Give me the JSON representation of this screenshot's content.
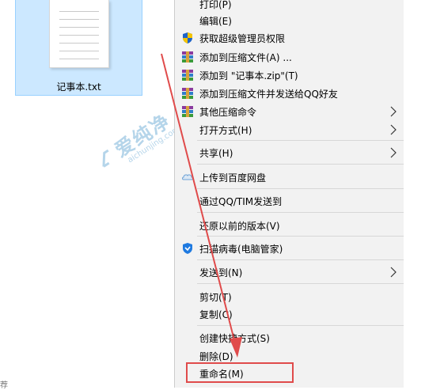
{
  "desktop": {
    "file_name": "记事本.txt",
    "partial_text": "荐"
  },
  "watermark": {
    "title": "爱纯净",
    "url": "aichunjing.com"
  },
  "context_menu": {
    "items": [
      {
        "label": "打印(P)"
      },
      {
        "label": "编辑(E)"
      },
      {
        "label": "获取超级管理员权限",
        "icon": "uac-shield-icon"
      },
      {
        "label": "添加到压缩文件(A) ...",
        "icon": "winrar-archive-icon"
      },
      {
        "label": "添加到 \"记事本.zip\"(T)",
        "icon": "winrar-archive-icon"
      },
      {
        "label": "添加到压缩文件并发送给QQ好友",
        "icon": "winrar-archive-icon"
      },
      {
        "label": "其他压缩命令",
        "icon": "winrar-archive-icon",
        "submenu": true
      },
      {
        "label": "打开方式(H)",
        "submenu": true
      },
      {
        "label": "共享(H)",
        "submenu": true
      },
      {
        "label": "上传到百度网盘",
        "icon": "baidu-netdisk-icon"
      },
      {
        "label": "通过QQ/TIM发送到"
      },
      {
        "label": "还原以前的版本(V)"
      },
      {
        "label": "扫描病毒(电脑管家)",
        "icon": "tencent-pc-manager-icon"
      },
      {
        "label": "发送到(N)",
        "submenu": true
      },
      {
        "label": "剪切(T)"
      },
      {
        "label": "复制(C)"
      },
      {
        "label": "创建快捷方式(S)"
      },
      {
        "label": "删除(D)"
      },
      {
        "label": "重命名(M)"
      }
    ]
  },
  "colors": {
    "menu_background": "#f2f2f2",
    "selection_tile": "#cce8ff",
    "annotation_red": "#e04b4b",
    "watermark_blue": "#7ab3d9"
  }
}
